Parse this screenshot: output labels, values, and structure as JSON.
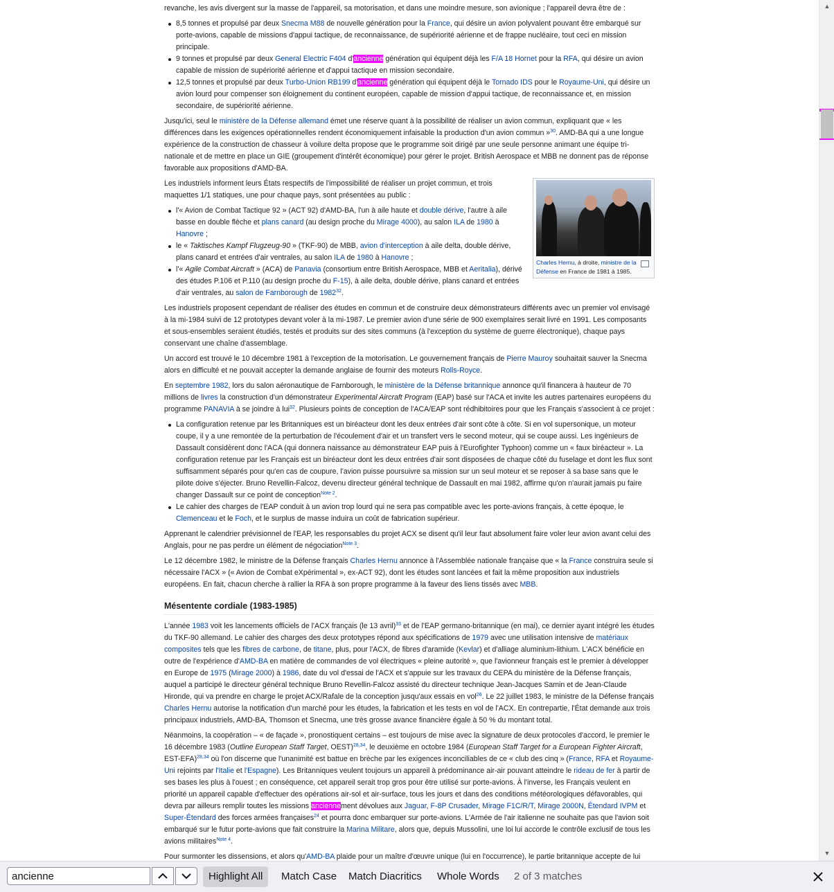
{
  "article": {
    "p0": "revanche, les avis divergent sur la masse de l'appareil, sa motorisation, et dans une moindre mesure, son avionique ; l'appareil devra être de :",
    "list1": {
      "i1": {
        "t1": "8,5 tonnes et propulsé par deux ",
        "l1": "Snecma M88",
        "t2": " de nouvelle génération pour la ",
        "l2": "France",
        "t3": ", qui désire un avion polyvalent pouvant être embarqué sur porte-avions, capable de missions d'appui tactique, de reconnaissance, de supériorité aérienne et de frappe nucléaire, tout ceci en mission principale."
      },
      "i2": {
        "t1": "9 tonnes et propulsé par deux ",
        "l1": "General Electric F404",
        "t2": " d'",
        "hl": "ancienne",
        "t3": " génération qui équipent déjà les ",
        "l2": "F/A 18 Hornet",
        "t4": " pour la ",
        "l3": "RFA",
        "t5": ", qui désire un avion capable de mission de supériorité aérienne et d'appui tactique en mission secondaire."
      },
      "i3": {
        "t1": "12,5 tonnes et propulsé par deux ",
        "l1": "Turbo-Union RB199",
        "t2": " d'",
        "hl": "ancienne",
        "t3": " génération qui équipent déjà le ",
        "l2": "Tornado IDS",
        "t4": " pour le ",
        "l3": "Royaume-Uni",
        "t5": ", qui désire un avion lourd pour compenser son éloignement du continent européen, capable de mission d'appui tactique, de reconnaissance et, en mission secondaire, de supériorité aérienne."
      }
    },
    "p1": {
      "t1": "Jusqu'ici, seul le ",
      "l1": "ministère de la Défense allemand",
      "t2": " émet une réserve quant à la possibilité de réaliser un avion commun, expliquant que « les différences dans les exigences opérationnelles rendent économiquement infaisable la production d'un avion commun »",
      "s1": "30",
      "t3": ". AMD-BA qui a une longue expérience de la construction de chasseur à voilure delta propose que le programme soit dirigé par une seule personne animant une équipe tri-nationale et de mettre en place un GIE (groupement d'intérêt économique) pour gérer le projet. British Aerospace et MBB ne donnent pas de réponse favorable aux propositions d'AMD-BA."
    },
    "thumb": {
      "l1": "Charles Hernu",
      "t1": ", à droite, ",
      "l2": "ministre de la Défense",
      "t2": " en France de 1981 à 1985."
    },
    "p2": "Les industriels informent leurs États respectifs de l'impossibilité de réaliser un projet commun, et trois maquettes 1/1 statiques, une pour chaque pays, sont présentées au public :",
    "list2": {
      "i1": {
        "t1": "l'« Avion de Combat Tactique 92 » (ACT 92) d'AMD-BA, l'un à aile haute et ",
        "l1": "double dérive",
        "t2": ", l'autre à aile basse en double flèche et ",
        "l2": "plans canard",
        "t3": " (au design proche du ",
        "l3": "Mirage 4000",
        "t4": "), au salon ",
        "l4": "ILA",
        "t5": " de ",
        "l5": "1980",
        "t6": " à ",
        "l6": "Hanovre",
        "t7": " ;"
      },
      "i2": {
        "t1": "le « ",
        "em": "Taktisches Kampf Flugzeug-90",
        "t2": " » (TKF-90) de MBB, ",
        "l1": "avion d'interception",
        "t3": " à aile delta, double dérive, plans canard et entrées d'air ventrales, au salon ",
        "l2": "ILA",
        "t4": " de ",
        "l3": "1980",
        "t5": " à ",
        "l4": "Hanovre",
        "t6": " ;"
      },
      "i3": {
        "t1": "l'« ",
        "em": "Agile Combat Aircraft",
        "t2": " » (ACA) de ",
        "l1": "Panavia",
        "t3": " (consortium entre British Aerospace, MBB et ",
        "l2": "Aeritalia",
        "t4": "), dérivé des études P.106 et P.110 (au design proche du ",
        "l3": "F-15",
        "t5": "), à aile delta, double dérive, plans canard et entrées d'air ventrales, au ",
        "l4": "salon de Farnborough",
        "t6": " de ",
        "l5": "1982",
        "s1": "32",
        "t7": "."
      }
    },
    "p3": "Les industriels proposent cependant de réaliser des études en commun et de construire deux démonstrateurs différents avec un premier vol envisagé à la mi-1984 suivi de 12 prototypes devant voler à la mi-1987. Le premier avion d'une série de 900 exemplaires serait livré en 1991. Les composants et sous-ensembles seraient étudiés, testés et produits sur des sites communs (à l'exception du système de guerre électronique), chaque pays conservant une chaîne d'assemblage.",
    "p4": {
      "t1": "Un accord est trouvé le 10 décembre 1981 à l'exception de la motorisation. Le gouvernement français de ",
      "l1": "Pierre Mauroy",
      "t2": " souhaitait sauver la Snecma alors en difficulté et ne pouvait accepter la demande anglaise de fournir des moteurs ",
      "l2": "Rolls-Royce",
      "t3": "."
    },
    "p5": {
      "t1": "En ",
      "l1": "septembre 1982",
      "t2": ", lors du salon aéronautique de Farnborough, le ",
      "l2": "ministère de la Défense britannique",
      "t3": " annonce qu'il financera à hauteur de 70 millions de ",
      "l3": "livres",
      "t4": " la construction d'un démonstrateur ",
      "em": "Experimental Aircraft Program",
      "t5": " (EAP) basé sur l'ACA et invite les autres partenaires européens du programme ",
      "l4": "PANAVIA",
      "t6": " à se joindre à lui",
      "s1": "32",
      "t7": ". Plusieurs points de conception de l'ACA/EAP sont rédhibitoires pour que les Français s'associent à ce projet :"
    },
    "list3": {
      "i1": {
        "t1": "La configuration retenue par les Britanniques est un biréacteur dont les deux entrées d'air sont côte à côte. Si en vol supersonique, un moteur coupe, il y a une remontée de la perturbation de l'écoulement d'air et un transfert vers le second moteur, qui se coupe aussi. Les ingénieurs de Dassault considèrent donc l'ACA (qui donnera naissance au démonstrateur EAP puis à l'Eurofighter Typhoon) comme un « faux biréacteur ». La configuration retenue par les Français est un biréacteur dont les deux entrées d'air sont disposées de chaque côté du fuselage et dont les flux sont suffisamment séparés pour qu'en cas de coupure, l'avion puisse poursuivre sa mission sur un seul moteur et se reposer à sa base sans que le pilote doive s'éjecter. Bruno Revellin-Falcoz, devenu directeur général technique de Dassault en mai 1982, affirme qu'on n'aurait jamais pu faire changer Dassault sur ce point de conception",
        "s1": "Note 2",
        "t2": "."
      },
      "i2": {
        "t1": "Le cahier des charges de l'EAP conduit à un avion trop lourd qui ne sera pas compatible avec les porte-avions français, à cette époque, le ",
        "l1": "Clemenceau",
        "t2": " et le ",
        "l2": "Foch",
        "t3": ", et le surplus de masse induira un coût de fabrication supérieur."
      }
    },
    "p6": {
      "t1": "Apprenant le calendrier prévisionnel de l'EAP, les responsables du projet ACX se disent qu'il leur faut absolument faire voler leur avion avant celui des Anglais, pour ne pas perdre un élément de négociation",
      "s1": "Note 3",
      "t2": "."
    },
    "p7": {
      "t1": "Le 12 décembre 1982, le ministre de la Défense français ",
      "l1": "Charles Hernu",
      "t2": " annonce à l'Assemblée nationale française que « la ",
      "l2": "France",
      "t3": " construira seule si nécessaire l'ACX » (« Avion de Combat eXpérimental », ex-ACT 92), dont les études sont lancées et fait la même proposition aux industriels européens. En fait, chacun cherche à rallier la RFA à son propre programme à la faveur des liens tissés avec ",
      "l3": "MBB",
      "t4": "."
    },
    "h_mesentente": "Mésentente cordiale (1983-1985)",
    "p8": {
      "t1": "L'année ",
      "l1": "1983",
      "t2": " voit les lancements officiels de l'ACX français (le 13 avril)",
      "s1": "33",
      "t3": " et de l'EAP germano-britannique (en mai), ce dernier ayant intégré les études du TKF-90 allemand. Le cahier des charges des deux prototypes répond aux spécifications de ",
      "l2": "1979",
      "t4": " avec une utilisation intensive de ",
      "l3": "matériaux composites",
      "t5": " tels que les ",
      "l4": "fibres de carbone",
      "t6": ", de ",
      "l5": "titane",
      "t7": ", plus, pour l'ACX, de fibres d'aramide (",
      "l6": "Kevlar",
      "t8": ") et d'alliage aluminium-lithium. L'ACX bénéficie en outre de l'expérience d'",
      "l7": "AMD-BA",
      "t9": " en matière de commandes de vol électriques « pleine autorité », que l'avionneur français est le premier à développer en Europe de ",
      "l8": "1975",
      "t10": " (",
      "l9": "Mirage 2000",
      "t11": ") à ",
      "l10": "1986",
      "t12": ", date du vol d'essai de l'ACX et s'appuie sur les travaux du CEPA du ministère de la Défense français, auquel a participé le directeur général technique Bruno Revellin-Falcoz assisté du directeur technique Jean-Jacques Samin et de Jean-Claude Hironde, qui va prendre en charge le projet ACX/Rafale de la conception jusqu'aux essais en vol",
      "s2": "26",
      "t13": ". Le 22 juillet 1983, le ministre de la Défense français ",
      "l11": "Charles Hernu",
      "t14": " autorise la notification d'un marché pour les études, la fabrication et les tests en vol de l'ACX. En contrepartie, l'État demande aux trois principaux industriels, AMD-BA, Thomson et Snecma, une très grosse avance financière égale à 50 % du montant total."
    },
    "p9": {
      "t1": "Néanmoins, la coopération – « de façade », pronostiquent certains – est toujours de mise avec la signature de deux protocoles d'accord, le premier le 16 décembre 1983 (",
      "em1": "Outline European Staff Target",
      "t2": ", OEST)",
      "s1": "28,34",
      "t3": ", le deuxième en octobre 1984 (",
      "em2": "European Staff Target for a European Fighter Aircraft",
      "t4": ", EST-EFA)",
      "s2": "28,34",
      "t5": " où l'on discerne que l'unanimité est battue en brèche par les exigences inconciliables de ce « club des cinq » (",
      "l1": "France",
      "t6": ", ",
      "l2": "RFA",
      "t7": " et ",
      "l3": "Royaume-Uni",
      "t8": " rejoints par ",
      "l4": "l'Italie",
      "t9": " et ",
      "l5": "l'Espagne",
      "t10": "). Les Britanniques veulent toujours un appareil à prédominance air-air pouvant atteindre le ",
      "l6": "rideau de fer",
      "t11": " à partir de ses bases les plus à l'ouest ; en conséquence, cet appareil serait trop gros pour être utilisé sur porte-avions. À l'inverse, les Français veulent en priorité un appareil capable d'effectuer des opérations air-sol et air-surface, tous les jours et dans des conditions météorologiques défavorables, qui devra par ailleurs remplir toutes les missions ",
      "hl": "ancienne",
      "t12": "ment dévolues aux ",
      "l7": "Jaguar",
      "t13": ", ",
      "l8": "F-8P Crusader",
      "t14": ", ",
      "l9": "Mirage F1C/R/T",
      "t15": ", ",
      "l10": "Mirage 2000N",
      "t16": ", ",
      "l11": "Étendard IVPM",
      "t17": " et ",
      "l12": "Super-Étendard",
      "t18": " des forces armées françaises",
      "s3": "24",
      "t19": " et pourra donc embarquer sur porte-avions. L'Armée de l'air italienne ne souhaite pas que l'avion soit embarqué sur le futur porte-avions que fait construire la ",
      "l13": "Marina Militare",
      "t20": ", alors que, depuis Mussolini, une loi lui accorde le contrôle exclusif de tous les avions militaires",
      "s4": "Note 4",
      "t21": "."
    },
    "p10": {
      "t1": "Pour surmonter les dissensions, et alors qu'",
      "l1": "AMD-BA",
      "t2": " plaide pour un maître d'œuvre unique (lui en l'occurrence), le partie britannique accepte de lui"
    }
  },
  "findbar": {
    "query": "ancienne",
    "highlight_all": "Highlight All",
    "match_case": "Match Case",
    "match_diacritics": "Match Diacritics",
    "whole_words": "Whole Words",
    "status": "2 of 3 matches"
  },
  "colors": {
    "highlight": "#ef0fff",
    "link": "#0645ad"
  }
}
